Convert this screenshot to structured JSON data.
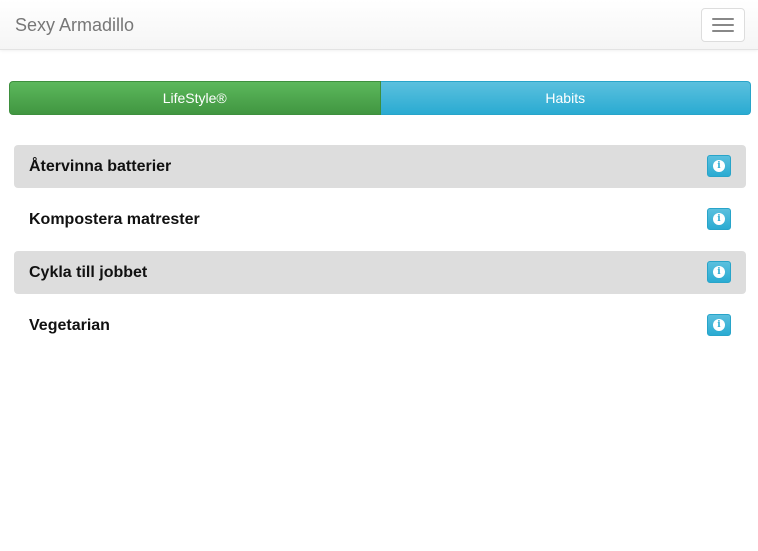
{
  "navbar": {
    "brand": "Sexy Armadillo",
    "toggle_icon": "hamburger-menu-icon"
  },
  "tabs": [
    {
      "label": "LifeStyle®",
      "color": "#5cb85c"
    },
    {
      "label": "Habits",
      "color": "#5bc0de"
    }
  ],
  "items": [
    {
      "label": "Återvinna batterier",
      "shaded": true
    },
    {
      "label": "Kompostera matrester",
      "shaded": false
    },
    {
      "label": "Cykla till jobbet",
      "shaded": true
    },
    {
      "label": "Vegetarian",
      "shaded": false
    }
  ],
  "info_icon": "info-icon",
  "info_glyph": "i",
  "colors": {
    "brand_text": "#777777",
    "row_shade": "#dddddd",
    "info_button": "#5bc0de"
  }
}
